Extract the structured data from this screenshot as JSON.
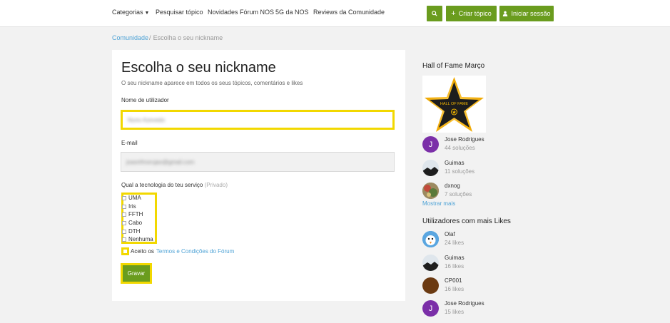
{
  "nav": {
    "categories": "Categorias",
    "search": "Pesquisar tópico",
    "news": "Novidades Fórum NOS",
    "fiveg": "5G da NOS",
    "reviews": "Reviews da Comunidade",
    "create_topic": "Criar tópico",
    "login": "Iniciar sessão"
  },
  "breadcrumb": {
    "home": "Comunidade",
    "current": "Escolha o seu nickname"
  },
  "form": {
    "title": "Escolha o seu nickname",
    "subtitle": "O seu nickname aparece em todos os seus tópicos, comentários e likes",
    "username_label": "Nome de utilizador",
    "username_value": "Nuno Azevedo",
    "email_label": "E-mail",
    "email_value": "joaonfmorujao@gmail.com",
    "tech_label": "Qual a tecnologia do teu serviço",
    "tech_private": "(Privado)",
    "tech_options": [
      "UMA",
      "Iris",
      "FFTH",
      "Cabo",
      "DTH",
      "Nenhuma"
    ],
    "terms_prefix": "Aceito os",
    "terms_link": "Termos e Condições do Fórum",
    "save": "Gravar"
  },
  "sidebar": {
    "hall_title": "Hall of Fame Março",
    "hall_badge": "HALL OF FAME",
    "hall_members": [
      {
        "name": "Jose Rodrigues",
        "stat": "44 soluções",
        "initial": "J"
      },
      {
        "name": "Guimas",
        "stat": "11 soluções"
      },
      {
        "name": "dxnog",
        "stat": "7 soluções"
      }
    ],
    "more": "Mostrar mais",
    "likes_title": "Utilizadores com mais Likes",
    "likes_members": [
      {
        "name": "Olaf",
        "stat": "24 likes"
      },
      {
        "name": "Guimas",
        "stat": "16 likes"
      },
      {
        "name": "CP001",
        "stat": "16 likes"
      },
      {
        "name": "Jose Rodrigues",
        "stat": "15 likes",
        "initial": "J"
      }
    ]
  },
  "colors": {
    "accent_green": "#6a9c1e",
    "highlight_yellow": "#f2d800",
    "link_blue": "#4fa3d6",
    "avatar_purple": "#7b2fa8"
  },
  "icons": [
    "chevron-down-icon",
    "search-icon",
    "plus-icon",
    "user-icon",
    "star-icon"
  ]
}
